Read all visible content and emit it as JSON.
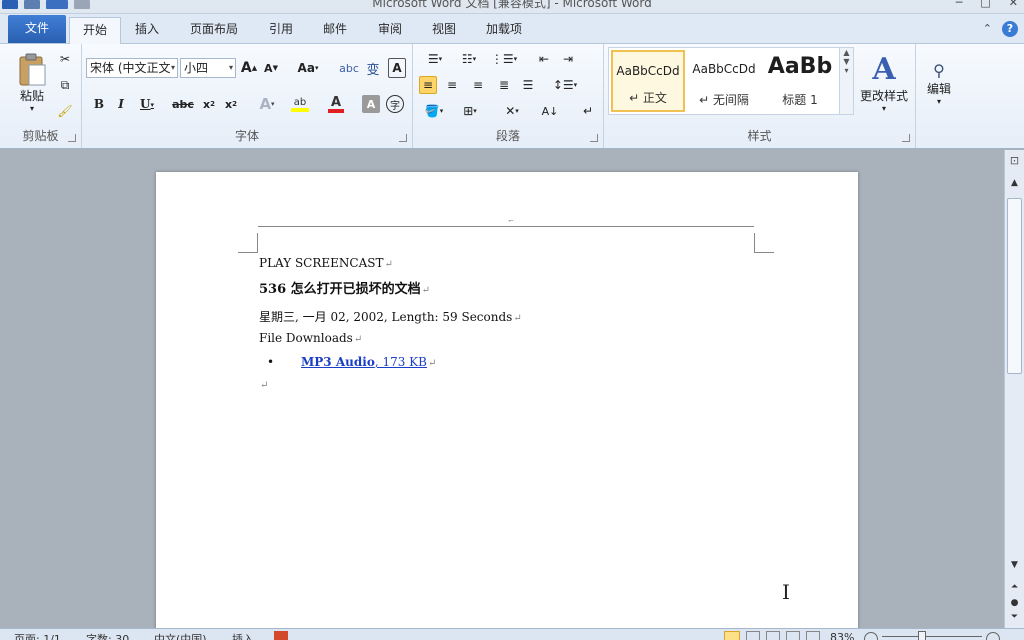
{
  "window": {
    "title": "Microsoft Word 文档 [兼容模式] - Microsoft Word"
  },
  "ribbon_tabs": [
    {
      "label": "文件"
    },
    {
      "label": "开始"
    },
    {
      "label": "插入"
    },
    {
      "label": "页面布局"
    },
    {
      "label": "引用"
    },
    {
      "label": "邮件"
    },
    {
      "label": "审阅"
    },
    {
      "label": "视图"
    },
    {
      "label": "加载项"
    }
  ],
  "clipboard": {
    "paste_label": "粘贴",
    "group_label": "剪贴板"
  },
  "font": {
    "font_name": "宋体 (中文正文",
    "font_size": "小四",
    "group_label": "字体"
  },
  "paragraph": {
    "group_label": "段落"
  },
  "styles": {
    "items": [
      {
        "sample": "AaBbCcDd",
        "name": "↵ 正文"
      },
      {
        "sample": "AaBbCcDd",
        "name": "↵ 无间隔"
      },
      {
        "sample": "AaBb",
        "name": "标题 1"
      }
    ],
    "change_styles_label": "更改样式",
    "group_label": "样式"
  },
  "editing": {
    "label": "编辑"
  },
  "document": {
    "line1": "PLAY SCREENCAST",
    "title": "536 怎么打开已损坏的文档",
    "meta": "星期三, 一月 02, 2002, Length: 59 Seconds",
    "downloads_label": "File Downloads",
    "bullet_char": "•",
    "link_bold": "MP3 Audio",
    "link_rest": ", 173 KB",
    "pilcrow": "↵"
  },
  "status": {
    "page": "页面: 1/1",
    "words": "字数: 30",
    "language": "中文(中国)",
    "mode": "插入",
    "zoom": "83%"
  },
  "colors": {
    "file_tab": "#2a5fb0",
    "highlight": "#ffff00",
    "font_color": "#e02020",
    "link": "#1a3fc4"
  }
}
